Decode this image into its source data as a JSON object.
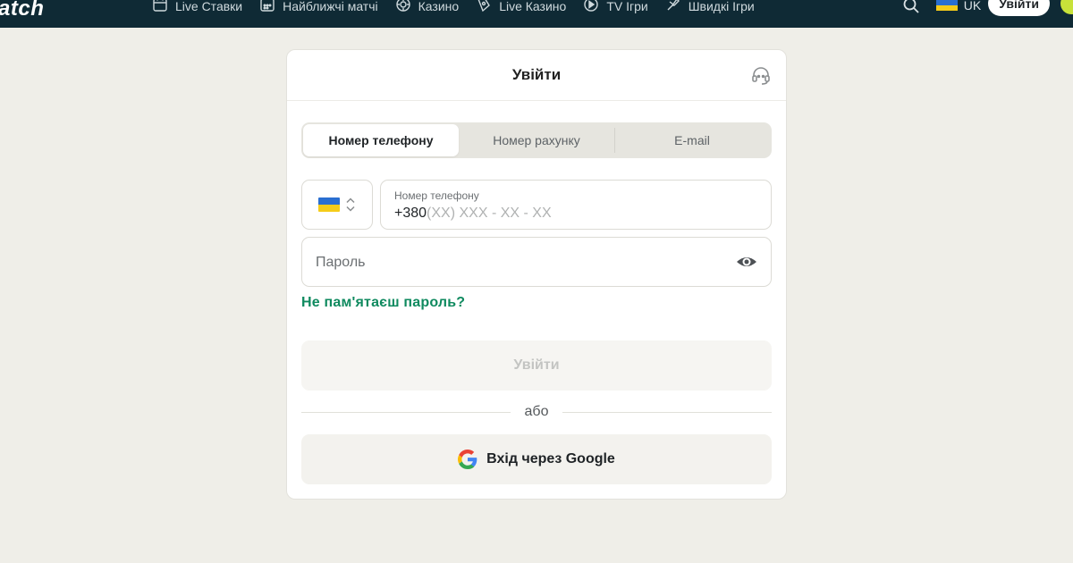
{
  "header": {
    "logo": "atch",
    "nav": [
      {
        "label": "Live Ставки",
        "icon": "live-calendar-icon"
      },
      {
        "label": "Найближчі матчі",
        "icon": "calendar-icon"
      },
      {
        "label": "Казино",
        "icon": "casino-chip-icon"
      },
      {
        "label": "Live Казино",
        "icon": "live-casino-icon"
      },
      {
        "label": "TV Ігри",
        "icon": "tv-games-icon"
      },
      {
        "label": "Швидкі Ігри",
        "icon": "quick-games-icon"
      }
    ],
    "language": "UK",
    "login_label": "Увійти"
  },
  "login_card": {
    "title": "Увійти",
    "tabs": [
      {
        "label": "Номер телефону",
        "active": true
      },
      {
        "label": "Номер рахунку",
        "active": false
      },
      {
        "label": "E-mail",
        "active": false
      }
    ],
    "phone": {
      "label": "Номер телефону",
      "prefix": "+380",
      "mask": "(XX) XXX - XX - XX"
    },
    "password_placeholder": "Пароль",
    "forgot_label": "Не пам'ятаєш пароль?",
    "submit_label": "Увійти",
    "or_label": "або",
    "google_label": "Вхід через Google"
  },
  "colors": {
    "header_bg": "#0f2a35",
    "page_bg": "#efeee8",
    "accent_green": "#0f8a5f",
    "flag_blue": "#2a6fd1",
    "flag_yellow": "#f5cc19"
  }
}
